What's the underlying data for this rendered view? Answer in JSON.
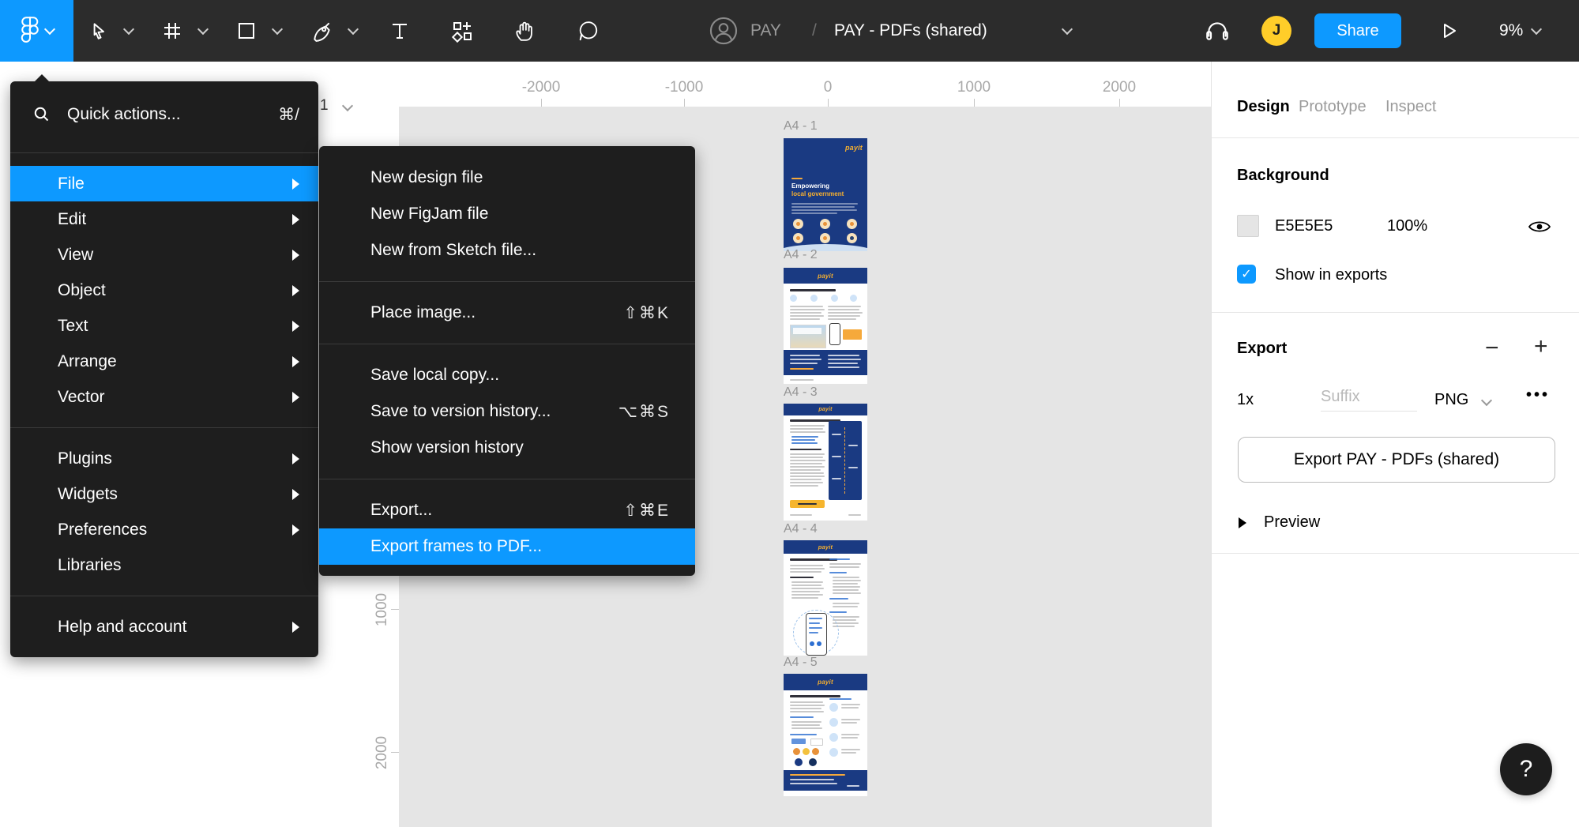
{
  "toolbar": {
    "project": "PAY",
    "breadcrumb_separator": "/",
    "file_name": "PAY - PDFs (shared)",
    "share": "Share",
    "zoom": "9%",
    "avatar_initial": "J"
  },
  "left_panel": {
    "page_indicator": "1"
  },
  "menu": {
    "quick_actions": "Quick actions...",
    "quick_actions_shortcut": "⌘/",
    "items": [
      {
        "label": "File"
      },
      {
        "label": "Edit"
      },
      {
        "label": "View"
      },
      {
        "label": "Object"
      },
      {
        "label": "Text"
      },
      {
        "label": "Arrange"
      },
      {
        "label": "Vector"
      },
      {
        "label": "Plugins"
      },
      {
        "label": "Widgets"
      },
      {
        "label": "Preferences"
      },
      {
        "label": "Libraries"
      },
      {
        "label": "Help and account"
      }
    ]
  },
  "file_submenu": {
    "items": [
      {
        "label": "New design file",
        "shortcut": ""
      },
      {
        "label": "New FigJam file",
        "shortcut": ""
      },
      {
        "label": "New from Sketch file...",
        "shortcut": ""
      },
      {
        "label": "Place image...",
        "shortcut": "⇧⌘K"
      },
      {
        "label": "Save local copy...",
        "shortcut": ""
      },
      {
        "label": "Save to version history...",
        "shortcut": "⌥⌘S"
      },
      {
        "label": "Show version history",
        "shortcut": ""
      },
      {
        "label": "Export...",
        "shortcut": "⇧⌘E"
      },
      {
        "label": "Export frames to PDF...",
        "shortcut": ""
      }
    ]
  },
  "ruler": {
    "horizontal_labels": [
      "-2000",
      "-1000",
      "0",
      "1000",
      "2000"
    ],
    "vertical_labels": [
      "1000",
      "2000"
    ]
  },
  "canvas": {
    "brand": "payit",
    "frames": [
      {
        "label": "A4 - 1"
      },
      {
        "label": "A4 - 2"
      },
      {
        "label": "A4 - 3"
      },
      {
        "label": "A4 - 4"
      },
      {
        "label": "A4 - 5"
      }
    ],
    "frame1": {
      "heading_line1": "Empowering",
      "heading_line2": "local government"
    }
  },
  "inspector": {
    "tabs": [
      "Design",
      "Prototype",
      "Inspect"
    ],
    "background": {
      "title": "Background",
      "color_hex": "E5E5E5",
      "opacity": "100%",
      "check": "✓",
      "show_in_exports": "Show in exports"
    },
    "export": {
      "title": "Export",
      "minus": "−",
      "plus": "+",
      "scale": "1x",
      "suffix_placeholder": "Suffix",
      "format": "PNG",
      "more": "•••",
      "button": "Export PAY - PDFs (shared)",
      "preview": "Preview"
    }
  },
  "help": {
    "label": "?"
  }
}
